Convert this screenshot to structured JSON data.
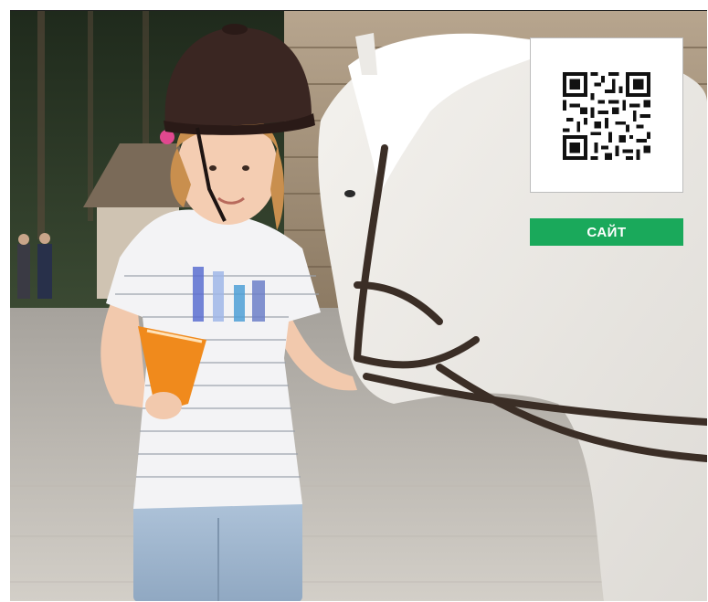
{
  "overlay": {
    "qr_code": "qr-code-icon",
    "site_button_label": "САЙТ",
    "site_button_color": "#1aa95b"
  },
  "photo": {
    "subject": "girl-feeding-white-pony-photo"
  }
}
